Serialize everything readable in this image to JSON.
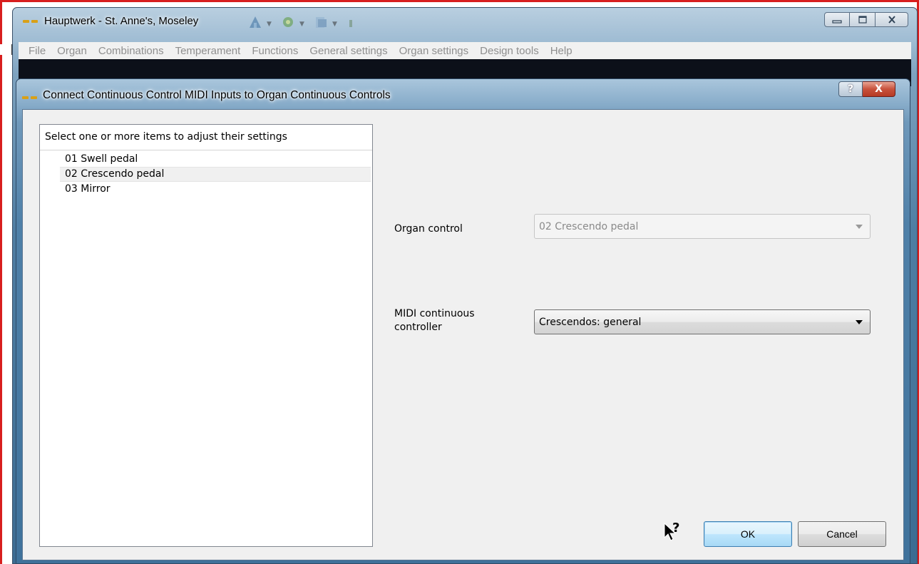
{
  "main_window": {
    "title": "Hauptwerk - St. Anne's, Moseley",
    "controls": {
      "minimize_icon": "minimize-icon",
      "maximize_icon": "maximize-icon",
      "close_icon": "close-icon"
    }
  },
  "menu": [
    {
      "label": "File"
    },
    {
      "label": "Organ"
    },
    {
      "label": "Combinations"
    },
    {
      "label": "Temperament"
    },
    {
      "label": "Functions"
    },
    {
      "label": "General settings"
    },
    {
      "label": "Organ settings"
    },
    {
      "label": "Design tools"
    },
    {
      "label": "Help"
    }
  ],
  "dialog": {
    "title": "Connect Continuous Control MIDI Inputs to Organ Continuous Controls",
    "help_button": "?",
    "close_button": "X",
    "list": {
      "header": "Select one or more items to adjust their settings",
      "items": [
        {
          "label": "01 Swell pedal",
          "selected": false
        },
        {
          "label": "02 Crescendo pedal",
          "selected": true
        },
        {
          "label": "03 Mirror",
          "selected": false
        }
      ]
    },
    "organ_control": {
      "label": "Organ control",
      "value": "02 Crescendo pedal",
      "enabled": false
    },
    "midi_controller": {
      "label_line1": "MIDI continuous",
      "label_line2": "controller",
      "value": "Crescendos: general",
      "enabled": true
    },
    "buttons": {
      "ok": "OK",
      "cancel": "Cancel"
    },
    "help_cursor_glyph": "?"
  },
  "colors": {
    "accent_red": "#d81e1e",
    "title_icon": "#d9a017",
    "window_frame": "#4f80a8"
  }
}
